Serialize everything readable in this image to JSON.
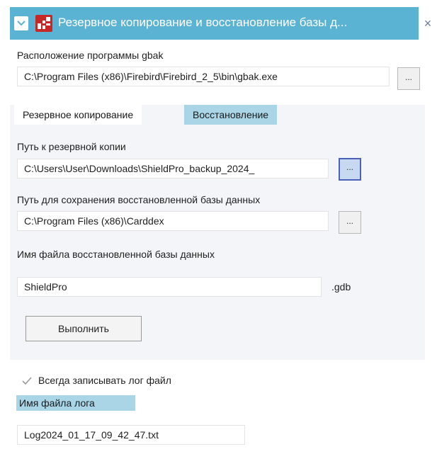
{
  "window": {
    "title": "Резервное копирование и восстановление базы д...",
    "close_glyph": "×",
    "accent_color": "#5bb3d3"
  },
  "gbak": {
    "label": "Расположение программы gbak",
    "path": "C:\\Program Files (x86)\\Firebird\\Firebird_2_5\\bin\\gbak.exe",
    "browse_label": "..."
  },
  "tabs": [
    {
      "label": "Резервное копирование",
      "active": false
    },
    {
      "label": "Восстановление",
      "active": true
    }
  ],
  "restore": {
    "backup_path_label": "Путь к резервной копии",
    "backup_path": "C:\\Users\\User\\Downloads\\ShieldPro_backup_2024_",
    "backup_browse": "...",
    "save_path_label": "Путь для сохранения восстановленной базы данных",
    "save_path": "C:\\Program Files (x86)\\Carddex",
    "save_browse": "...",
    "db_name_label": "Имя файла восстановленной базы данных",
    "db_name": "ShieldPro",
    "extension": ".gdb",
    "execute_label": "Выполнить"
  },
  "log": {
    "always_write_label": "Всегда записывать лог файл",
    "always_write_checked": true,
    "log_name_label": "Имя файла лога",
    "log_name": "Log2024_01_17_09_42_47.txt"
  },
  "icons": {
    "title_menu": "chevron-down-icon",
    "app": "app-icon",
    "close": "close-icon",
    "checkbox": "checkmark-icon"
  }
}
